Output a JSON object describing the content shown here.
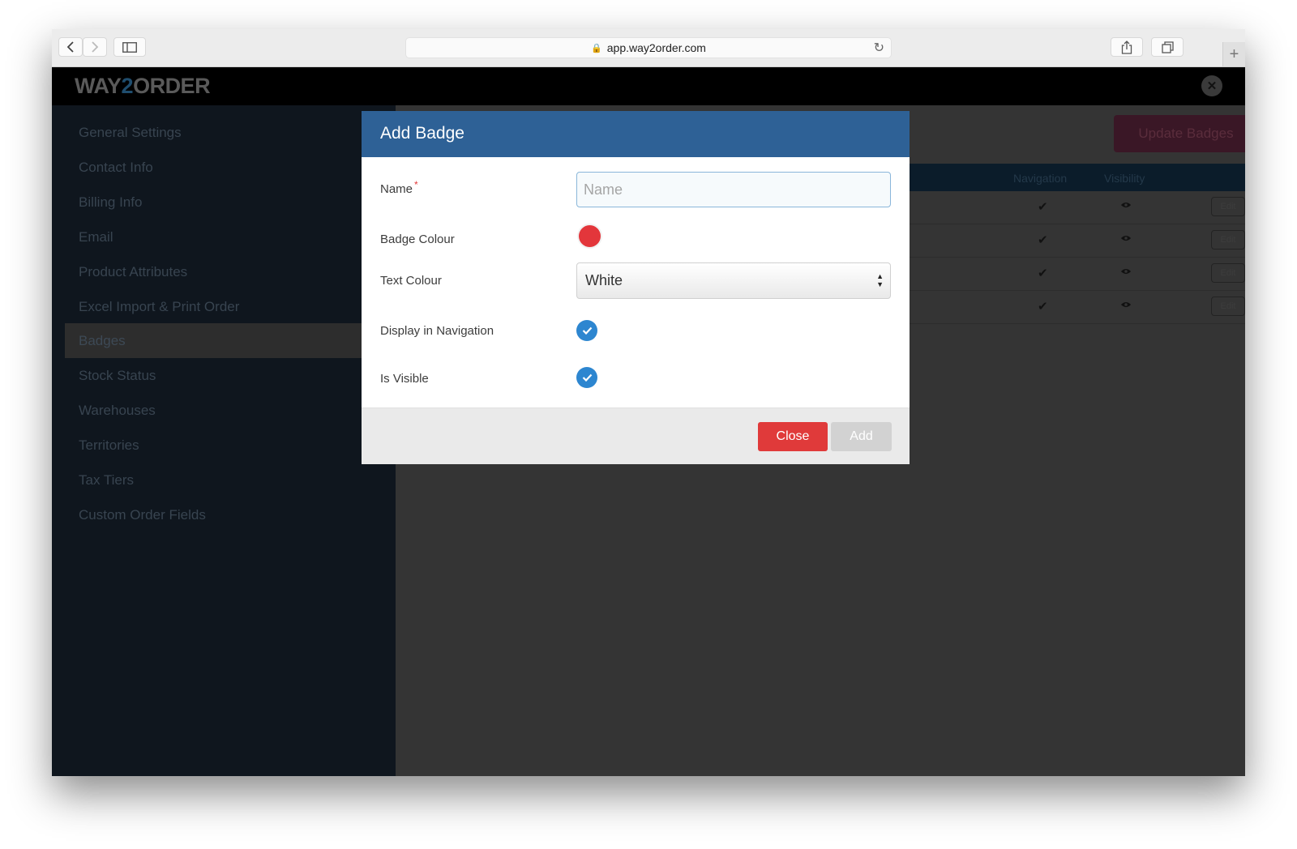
{
  "browser": {
    "url": "app.way2order.com",
    "icons": [
      "back-icon",
      "forward-icon",
      "sidebar-toggle-icon",
      "lock-icon",
      "reload-icon",
      "share-icon",
      "tabs-icon",
      "new-tab-icon"
    ]
  },
  "app": {
    "logo_a": "WAY",
    "logo_b": "2",
    "logo_c": "ORDER",
    "update_button": "Update Badges"
  },
  "sidebar": {
    "items": [
      {
        "label": "General Settings"
      },
      {
        "label": "Contact Info"
      },
      {
        "label": "Billing Info"
      },
      {
        "label": "Email"
      },
      {
        "label": "Product Attributes"
      },
      {
        "label": "Excel Import & Print Order"
      },
      {
        "label": "Badges"
      },
      {
        "label": "Stock Status"
      },
      {
        "label": "Warehouses"
      },
      {
        "label": "Territories"
      },
      {
        "label": "Tax Tiers"
      },
      {
        "label": "Custom Order Fields"
      }
    ],
    "active_item": "Badges"
  },
  "table": {
    "columns": [
      "Navigation",
      "Visibility"
    ],
    "rows": [
      {
        "navigation": "✔",
        "edit": "Edit"
      },
      {
        "navigation": "✔",
        "edit": "Edit"
      },
      {
        "navigation": "✔",
        "edit": "Edit"
      },
      {
        "navigation": "✔",
        "edit": "Edit"
      }
    ]
  },
  "modal": {
    "title": "Add Badge",
    "name_label": "Name",
    "required_mark": "*",
    "name_placeholder": "Name",
    "name_value": "",
    "badge_colour_label": "Badge Colour",
    "badge_colour_value": "#e3363b",
    "text_colour_label": "Text Colour",
    "text_colour_value": "White",
    "display_nav_label": "Display in Navigation",
    "display_nav_checked": true,
    "is_visible_label": "Is Visible",
    "is_visible_checked": true,
    "close_button": "Close",
    "add_button": "Add"
  },
  "colors": {
    "modal_header": "#2e6196",
    "close_button": "#e03a3a",
    "checkbox": "#2d86d0",
    "add_disabled": "#d2d2d2"
  }
}
